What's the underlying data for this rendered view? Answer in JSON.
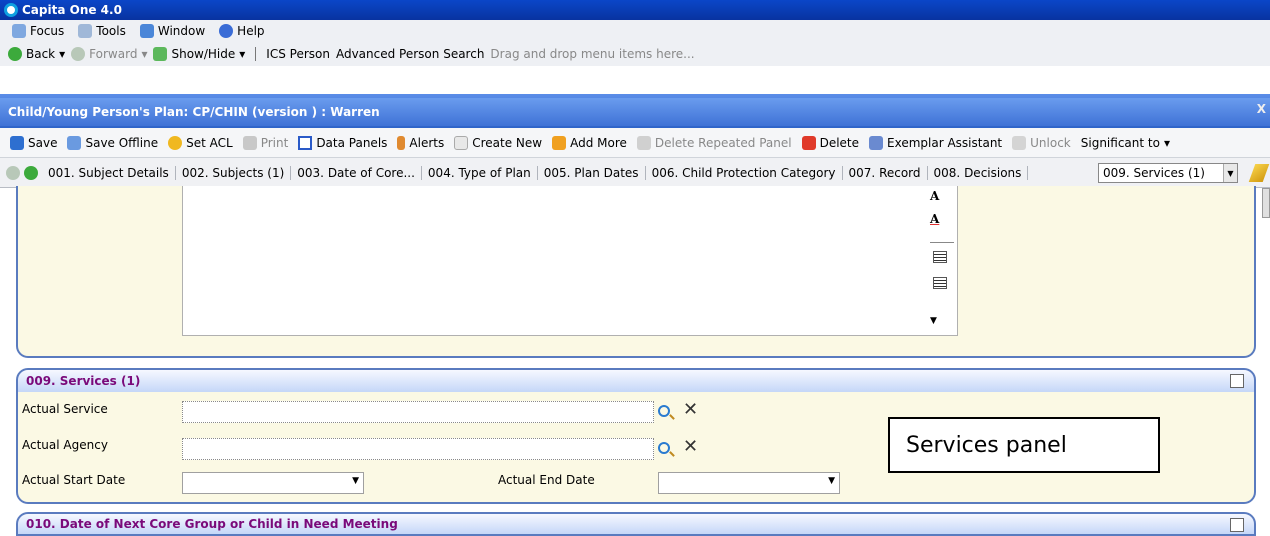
{
  "window": {
    "title": "Capita One 4.0"
  },
  "menu": {
    "focus": "Focus",
    "tools": "Tools",
    "window": "Window",
    "help": "Help"
  },
  "nav": {
    "back": "Back",
    "forward": "Forward",
    "show_hide": "Show/Hide",
    "ics_person": "ICS Person",
    "advanced_search": "Advanced Person Search",
    "drag_hint": "Drag and drop menu items here..."
  },
  "plan": {
    "title": "Child/Young Person's Plan: CP/CHIN (version ) : Warren",
    "close": "X"
  },
  "toolbar": {
    "save": "Save",
    "save_offline": "Save Offline",
    "set_acl": "Set ACL",
    "print": "Print",
    "data_panels": "Data Panels",
    "alerts": "Alerts",
    "create_new": "Create New",
    "add_more": "Add More",
    "delete_repeated": "Delete Repeated Panel",
    "delete": "Delete",
    "exemplar": "Exemplar Assistant",
    "unlock": "Unlock",
    "significant": "Significant to"
  },
  "tabs": [
    "001. Subject Details",
    "002. Subjects (1)",
    "003. Date of Core...",
    "004. Type of Plan",
    "005. Plan Dates",
    "006. Child Protection Category",
    "007. Record",
    "008. Decisions"
  ],
  "tab_select": {
    "value": "009. Services (1)"
  },
  "format": {
    "font_a": "A",
    "color_a": "A"
  },
  "services": {
    "title": "009. Services (1)",
    "actual_service": "Actual Service",
    "actual_agency": "Actual Agency",
    "actual_start": "Actual Start Date",
    "actual_end": "Actual End Date"
  },
  "callout": "Services panel",
  "next_section": {
    "title": "010. Date of Next Core Group or Child in Need Meeting"
  },
  "colors": {
    "title_bar": "#0a46c8",
    "panel_border": "#5a7bbf",
    "panel_bg": "#fbf9e4",
    "section_title": "#7a0a7a"
  }
}
